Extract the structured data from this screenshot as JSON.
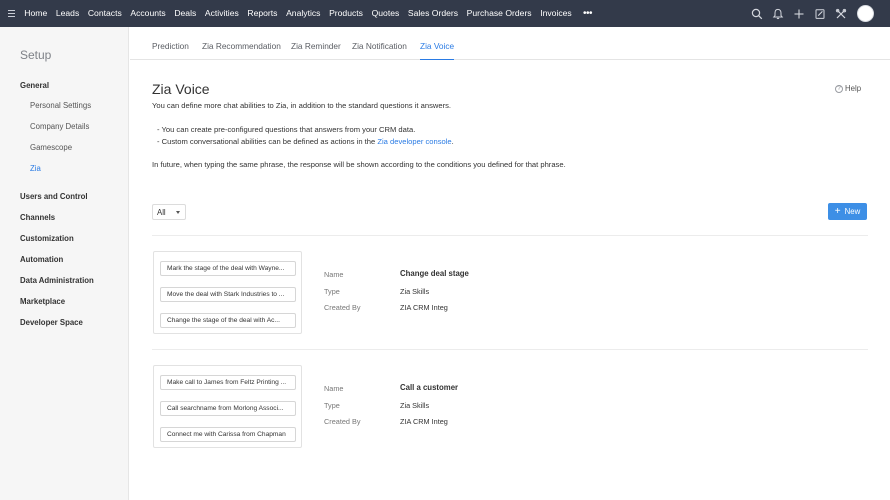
{
  "topnav": {
    "items": [
      "Home",
      "Leads",
      "Contacts",
      "Accounts",
      "Deals",
      "Activities",
      "Reports",
      "Analytics",
      "Products",
      "Quotes",
      "Sales Orders",
      "Purchase Orders",
      "Invoices"
    ],
    "more": "•••",
    "icons": [
      "search-icon",
      "bell-icon",
      "plus-icon",
      "compose-icon",
      "tools-icon",
      "avatar"
    ]
  },
  "sidebar": {
    "title": "Setup",
    "groups": {
      "general": "General",
      "general_items": [
        "Personal Settings",
        "Company Details",
        "Gamescope",
        "Zia"
      ],
      "others": [
        "Users and Control",
        "Channels",
        "Customization",
        "Automation",
        "Data Administration",
        "Marketplace",
        "Developer Space"
      ]
    },
    "active": "Zia"
  },
  "tabs": [
    "Prediction",
    "Zia Recommendation",
    "Zia Reminder",
    "Zia Notification",
    "Zia Voice"
  ],
  "active_tab": "Zia Voice",
  "main": {
    "title": "Zia Voice",
    "help": "Help",
    "intro": "You can define more chat abilities to Zia, in addition to the standard questions it answers.",
    "bullet1": "- You can create pre-configured questions that answers from your CRM data.",
    "bullet2_prefix": "- Custom conversational abilities can be defined as actions in the ",
    "bullet2_link": "Zia developer console",
    "bullet2_suffix": ".",
    "future": "In future, when typing the same phrase, the response will be shown according to the conditions you defined for that phrase.",
    "filter_value": "All",
    "new_button": "New",
    "new_icon": "+"
  },
  "labels": {
    "name": "Name",
    "type": "Type",
    "created_by": "Created By"
  },
  "abilities": [
    {
      "phrases": [
        "Mark the stage of the deal with Wayne...",
        "Move the deal with Stark Industries to ...",
        "Change the stage of the deal with Ac..."
      ],
      "name": "Change deal stage",
      "type": "Zia Skills",
      "created_by": "ZIA CRM Integ"
    },
    {
      "phrases": [
        "Make call to James from Feltz Printing ...",
        "Call searchname from Morlong Associ...",
        "Connect me with Carissa from Chapman"
      ],
      "name": "Call a customer",
      "type": "Zia Skills",
      "created_by": "ZIA CRM Integ"
    }
  ]
}
